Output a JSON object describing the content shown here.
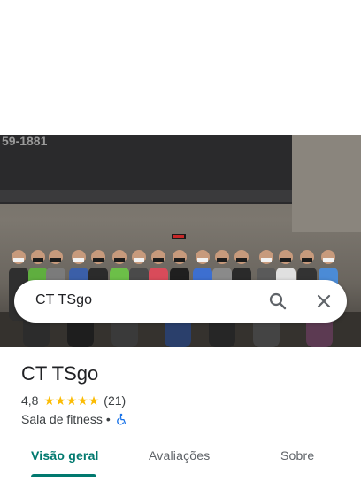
{
  "search": {
    "query": "CT TSgo"
  },
  "hero": {
    "wall_text": "59-1881"
  },
  "place": {
    "title": "CT TSgo",
    "rating": "4,8",
    "stars": [
      "★",
      "★",
      "★",
      "★",
      "★"
    ],
    "review_count": "(21)",
    "category": "Sala de fitness",
    "separator": "•",
    "accessibility_icon": "wheelchair-icon"
  },
  "tabs": [
    {
      "label": "Visão geral",
      "active": true
    },
    {
      "label": "Avaliações",
      "active": false
    },
    {
      "label": "Sobre",
      "active": false
    }
  ],
  "colors": {
    "accent": "#01796f",
    "star": "#fbbc04",
    "accessibility": "#1a73e8"
  }
}
